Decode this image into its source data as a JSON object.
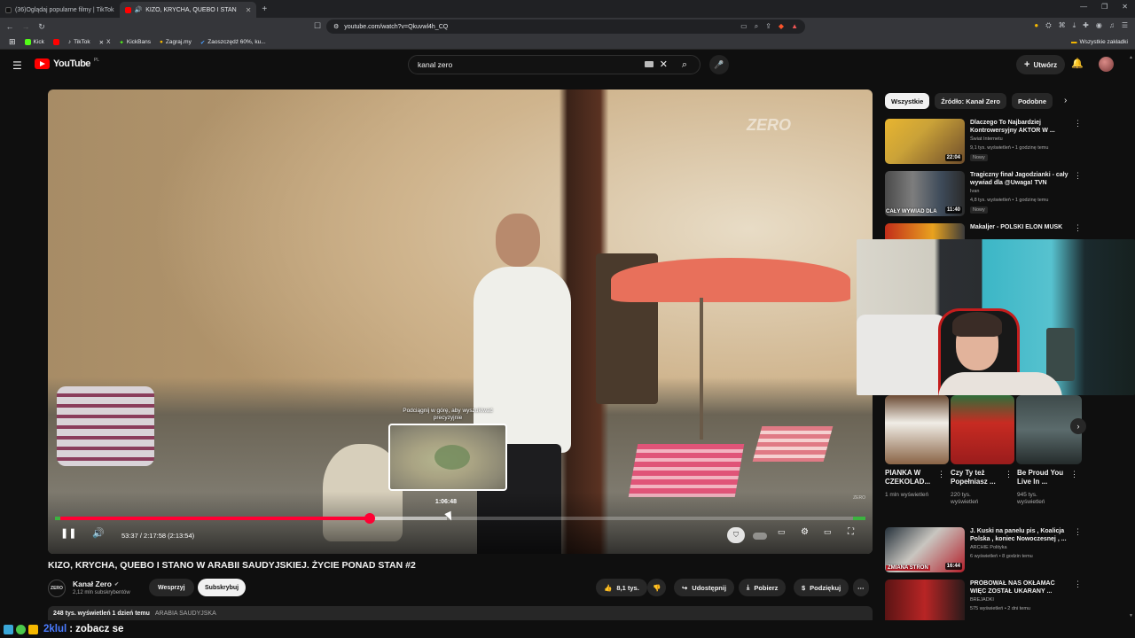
{
  "browser": {
    "tabs": [
      {
        "label": "(36)Oglądaj popularne filmy | TikTok",
        "active": false
      },
      {
        "label": "KIZO, KRYCHA, QUEBO I STAN",
        "active": true
      }
    ],
    "url": "youtube.com/watch?v=Qkuvwl4h_CQ",
    "bookmarks": [
      "Kick",
      "TikTok",
      "X",
      "KickBans",
      "Zagraj.my",
      "Zaoszczędź 60%, ku..."
    ],
    "all_bookmarks": "Wszystkie zakładki"
  },
  "masthead": {
    "logo_text": "YouTube",
    "logo_region": "PL",
    "search_value": "kanal zero",
    "create_label": "Utwórz"
  },
  "player": {
    "watermark": "ZERO",
    "seek_hint": "Podciągnij w górę, aby wyszukiwać precyzyjnie",
    "preview_time": "1:06:48",
    "time_display": "53:37 / 2:17:58 (2:13:54)",
    "played_fraction": 0.3886,
    "buffer_fraction": 0.4841,
    "hover_fraction": 0.4841
  },
  "video": {
    "title": "KIZO, KRYCHA, QUEBO I STANO W ARABII SAUDYJSKIEJ. ŻYCIE PONAD STAN #2",
    "channel_name": "Kanał Zero",
    "channel_subs": "2,12 mln subskrybentów",
    "support_label": "Wesprzyj",
    "subscribe_label": "Subskrybuj",
    "likes": "8,1 tys.",
    "share_label": "Udostępnij",
    "download_label": "Pobierz",
    "thanks_label": "Podziękuj",
    "views_date": "248 tys. wyświetleń  1 dzień temu",
    "hashtag": "ARABIA SAUDYJSKA"
  },
  "sidebar": {
    "chips": [
      "Wszystkie",
      "Źródło: Kanał Zero",
      "Podobne"
    ],
    "recommendations": [
      {
        "title": "Dlaczego To Najbardziej Kontrowersyjny AKTOR W ...",
        "channel": "Świat Internetu",
        "meta": "9,1 tys. wyświetleń • 1 godzinę temu",
        "badge": "Nowy",
        "duration": "22:04",
        "caption": ""
      },
      {
        "title": "Tragiczny finał Jagodzianki - cały wywiad dla @Uwaga! TVN",
        "channel": "Ivan",
        "meta": "4,8 tys. wyświetleń • 1 godzinę temu",
        "badge": "Nowy",
        "duration": "11:40",
        "caption": "CAŁY WYWIAD DLA"
      },
      {
        "title": "Makaljer - POLSKI ELON MUSK",
        "channel": "",
        "meta": "",
        "badge": "",
        "duration": "",
        "caption": ""
      },
      {
        "title": "J. Kuski na panelu pis , Koalicja Polska , koniec Nowoczesnej , ...",
        "channel": "ARCHIE Polityka",
        "meta": "6 wyświetleń • 8 godzin temu",
        "badge": "",
        "duration": "16:44",
        "caption": "ZMIANA STRON"
      },
      {
        "title": "PRÓBOWAŁ NAS OKŁAMAĆ WIĘC ZOSTAŁ UKARANY ...",
        "channel": "BREJADKI",
        "meta": "575 wyświetleń • 2 dni temu",
        "badge": "",
        "duration": "",
        "caption": ""
      }
    ],
    "shorts": [
      {
        "title": "PIANKA W CZEKOLAD...",
        "views": "1 mln wyświetleń"
      },
      {
        "title": "Czy Ty też Popełniasz ...",
        "views": "220 tys. wyświetleń"
      },
      {
        "title": "Be Proud You Live In ...",
        "views": "945 tys. wyświetleń"
      }
    ]
  },
  "chat": {
    "user": "2klul",
    "message": "zobacz se"
  },
  "colors": {
    "accent": "#ff0033",
    "background": "#0f0f0f",
    "chat_user": "#4a7bff"
  }
}
